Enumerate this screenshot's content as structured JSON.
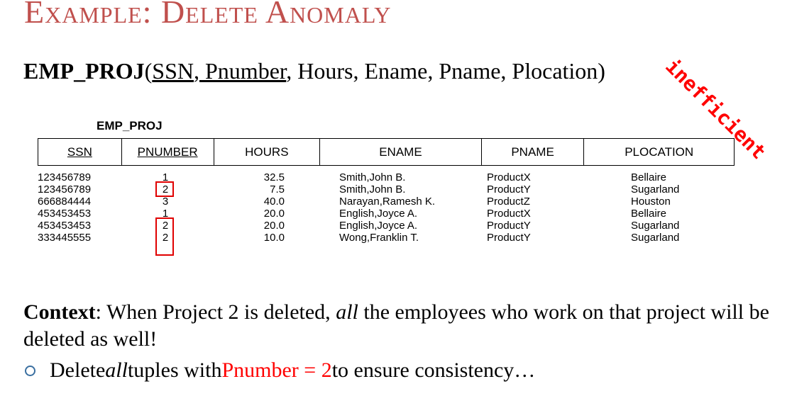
{
  "slide": {
    "title": "Example: Delete Anomaly",
    "stamp": "inefficient"
  },
  "schema": {
    "relation": "EMP_PROJ",
    "open": "(",
    "key1": "SSN",
    "sep": ", ",
    "key2": "Pnumber",
    "rest": ", Hours, Ename, Pname, Plocation)"
  },
  "table": {
    "caption": "EMP_PROJ",
    "headers": [
      "SSN",
      "PNUMBER",
      "HOURS",
      "ENAME",
      "PNAME",
      "PLOCATION"
    ],
    "rows": [
      {
        "ssn": "123456789",
        "pnumber": "1",
        "hours": "32.5",
        "ename": "Smith,John B.",
        "pname": "ProductX",
        "plocation": "Bellaire"
      },
      {
        "ssn": "123456789",
        "pnumber": "2",
        "hours": "7.5",
        "ename": "Smith,John B.",
        "pname": "ProductY",
        "plocation": "Sugarland"
      },
      {
        "ssn": "666884444",
        "pnumber": "3",
        "hours": "40.0",
        "ename": "Narayan,Ramesh K.",
        "pname": "ProductZ",
        "plocation": "Houston"
      },
      {
        "ssn": "453453453",
        "pnumber": "1",
        "hours": "20.0",
        "ename": "English,Joyce A.",
        "pname": "ProductX",
        "plocation": "Bellaire"
      },
      {
        "ssn": "453453453",
        "pnumber": "2",
        "hours": "20.0",
        "ename": "English,Joyce A.",
        "pname": "ProductY",
        "plocation": "Sugarland"
      },
      {
        "ssn": "333445555",
        "pnumber": "2",
        "hours": "10.0",
        "ename": "Wong,Franklin T.",
        "pname": "ProductY",
        "plocation": "Sugarland"
      }
    ]
  },
  "context": {
    "label": "Context",
    "t1": ": When Project 2 is deleted, ",
    "all": "all",
    "t2": " the employees who work on that project will be deleted as well!"
  },
  "bullet": {
    "t1": "Delete ",
    "all": "all",
    "t2": " tuples with ",
    "highlight": "Pnumber = 2",
    "t3": " to ensure consistency…"
  },
  "colors": {
    "title": "#c0504d",
    "highlight": "#ff0000",
    "box": "#e00000"
  }
}
